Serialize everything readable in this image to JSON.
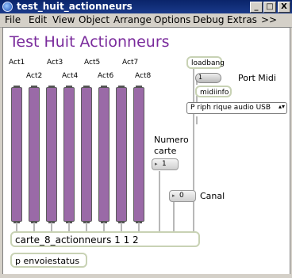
{
  "window": {
    "title": "test_huit_actionneurs",
    "minimize_glyph": "_",
    "maximize_glyph": "□",
    "close_glyph": "X"
  },
  "menubar": {
    "items": [
      "File",
      "Edit",
      "View",
      "Object",
      "Arrange",
      "Options",
      "Debug",
      "Extras",
      ">>"
    ]
  },
  "patch": {
    "title": "Test Huit Actionneurs",
    "act_labels": [
      "Act1",
      "Act2",
      "Act3",
      "Act4",
      "Act5",
      "Act6",
      "Act7",
      "Act8"
    ],
    "loadbang": "loadbang",
    "toggle_value": "1",
    "midiinfo": "midiinfo",
    "port_midi_label": "Port Midi",
    "port_menu": {
      "selected": "P   riph   rique audio USB",
      "arrow": "▴▾"
    },
    "numero_carte_line1": "Numero",
    "numero_carte_line2": "carte",
    "carte_number": "1",
    "canal_number": "0",
    "canal_label": "Canal",
    "main_object": "carte_8_actionneurs 1 1 2",
    "status_object": "p envoiestatus"
  },
  "colors": {
    "title": "#7a2b9c",
    "slider": "#9a6aa7",
    "object_border": "#c8d2b4"
  }
}
